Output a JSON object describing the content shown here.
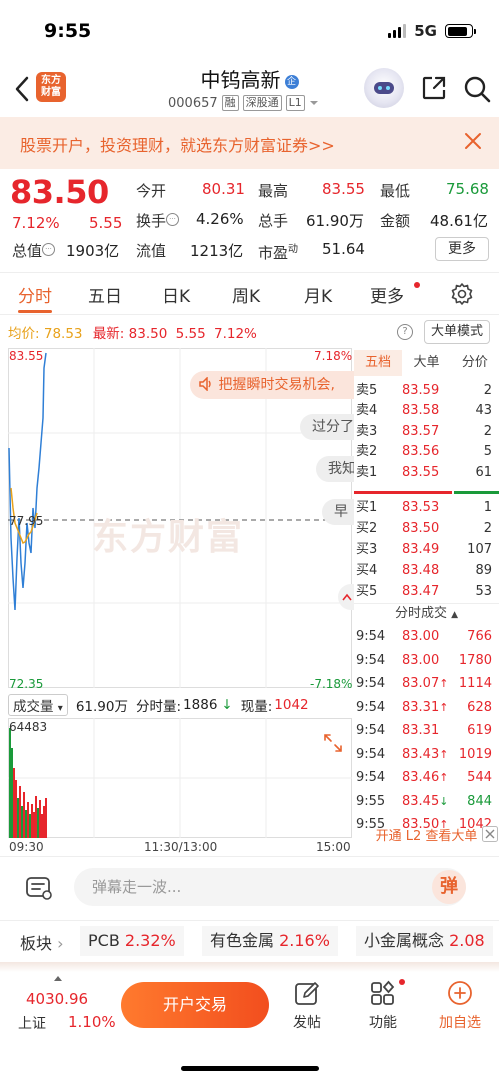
{
  "status": {
    "time": "9:55",
    "network": "5G"
  },
  "header": {
    "logo_text": "东方\n财富",
    "name": "中钨高新",
    "badge": "企",
    "code": "000657",
    "tags": [
      "融",
      "深股通",
      "L1"
    ]
  },
  "banner": {
    "text": "股票开户，投资理财，就选东方财富证券>>"
  },
  "quote": {
    "price": "83.50",
    "change_pct": "7.12%",
    "change": "5.55",
    "open_label": "今开",
    "open": "80.31",
    "high_label": "最高",
    "high": "83.55",
    "low_label": "最低",
    "low": "75.68",
    "turnover_label": "换手",
    "turnover": "4.26%",
    "volume_label": "总手",
    "volume": "61.90万",
    "amount_label": "金额",
    "amount": "48.61亿",
    "mcap_label": "总值",
    "mcap": "1903亿",
    "float_label": "流值",
    "float": "1213亿",
    "pe_label": "市盈",
    "pe_sup": "动",
    "pe": "51.64",
    "more": "更多"
  },
  "tabs": [
    "分时",
    "五日",
    "日K",
    "周K",
    "月K",
    "更多"
  ],
  "intraday": {
    "avg_label": "均价:",
    "avg": "78.53",
    "latest_label": "最新:",
    "latest": "83.50",
    "latest_chg": "5.55",
    "latest_pct": "7.12%",
    "big_order_mode": "大单模式",
    "y_top": "83.55",
    "y_mid": "77.95",
    "y_bot": "72.35",
    "pct_top": "7.18%",
    "pct_bot": "-7.18%",
    "watermark": "东方财富",
    "vol_label": "成交量",
    "vol_summary": "61.90万",
    "vol_tick_label": "分时量:",
    "vol_tick": "1886",
    "vol_now_label": "现量:",
    "vol_now": "1042",
    "vol_max": "64483",
    "x_labels": [
      "09:30",
      "11:30/13:00",
      "15:00"
    ]
  },
  "overlay": {
    "promo": "把握瞬时交易机会,",
    "bullets": [
      "过分了",
      "我知",
      "早"
    ]
  },
  "orderbook": {
    "tabs": [
      "五档",
      "大单",
      "分价"
    ],
    "asks": [
      {
        "label": "卖5",
        "price": "83.59",
        "vol": "2"
      },
      {
        "label": "卖4",
        "price": "83.58",
        "vol": "43"
      },
      {
        "label": "卖3",
        "price": "83.57",
        "vol": "2"
      },
      {
        "label": "卖2",
        "price": "83.56",
        "vol": "5"
      },
      {
        "label": "卖1",
        "price": "83.55",
        "vol": "61"
      }
    ],
    "bids": [
      {
        "label": "买1",
        "price": "83.53",
        "vol": "1"
      },
      {
        "label": "买2",
        "price": "83.50",
        "vol": "2"
      },
      {
        "label": "买3",
        "price": "83.49",
        "vol": "107"
      },
      {
        "label": "买4",
        "price": "83.48",
        "vol": "89"
      },
      {
        "label": "买5",
        "price": "83.47",
        "vol": "53"
      }
    ],
    "ticks_header": "分时成交",
    "ticks": [
      {
        "time": "9:54",
        "price": "83.00",
        "dir": "",
        "vol": "766",
        "color": "red"
      },
      {
        "time": "9:54",
        "price": "83.00",
        "dir": "",
        "vol": "1780",
        "color": "red"
      },
      {
        "time": "9:54",
        "price": "83.07",
        "dir": "↑",
        "vol": "1114",
        "color": "red"
      },
      {
        "time": "9:54",
        "price": "83.31",
        "dir": "↑",
        "vol": "628",
        "color": "red"
      },
      {
        "time": "9:54",
        "price": "83.31",
        "dir": "",
        "vol": "619",
        "color": "red"
      },
      {
        "time": "9:54",
        "price": "83.43",
        "dir": "↑",
        "vol": "1019",
        "color": "red"
      },
      {
        "time": "9:54",
        "price": "83.46",
        "dir": "↑",
        "vol": "544",
        "color": "red"
      },
      {
        "time": "9:55",
        "price": "83.45",
        "dir": "↓",
        "vol": "844",
        "color": "green"
      },
      {
        "time": "9:55",
        "price": "83.50",
        "dir": "↑",
        "vol": "1042",
        "color": "red"
      }
    ],
    "l2_link": "开通 L2 查看大单"
  },
  "comment": {
    "placeholder": "弹幕走一波...",
    "danmu": "弹"
  },
  "sectors": {
    "label": "板块",
    "items": [
      {
        "name": "PCB",
        "pct": "2.32%"
      },
      {
        "name": "有色金属",
        "pct": "2.16%"
      },
      {
        "name": "小金属概念",
        "pct": "2.08"
      }
    ]
  },
  "bottom": {
    "index_value": "4030.96",
    "index_name": "上证",
    "index_pct": "1.10%",
    "trade": "开户交易",
    "nav": [
      "发帖",
      "功能",
      "加自选"
    ]
  },
  "colors": {
    "up": "#e6262c",
    "down": "#1a9a3a",
    "accent": "#e8632e"
  }
}
